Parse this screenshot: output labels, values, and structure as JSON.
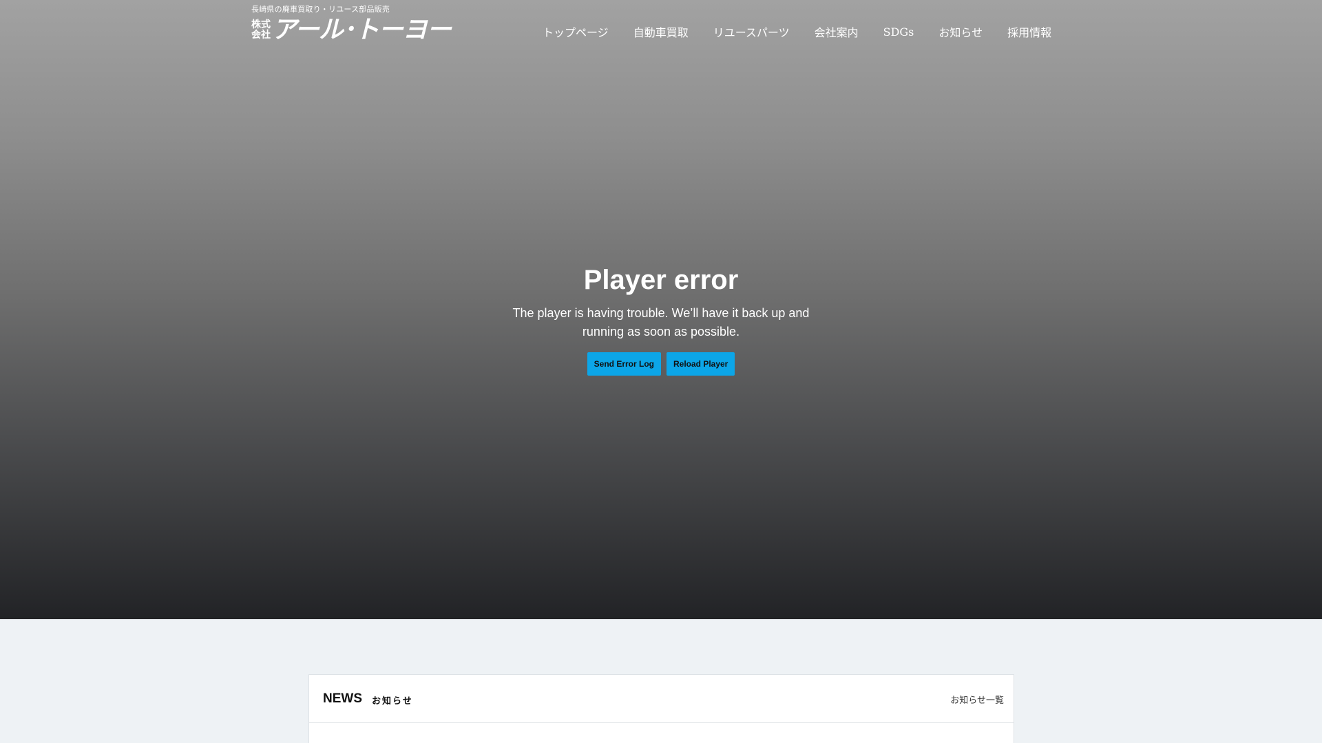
{
  "header": {
    "tagline": "長崎県の廃車買取り・リユース部品販売",
    "logo_corp_line1": "株式",
    "logo_corp_line2": "会社",
    "logo_name": "アール･トーヨー"
  },
  "nav": {
    "items": [
      {
        "label": "トップページ"
      },
      {
        "label": "自動車買取"
      },
      {
        "label": "リユースパーツ"
      },
      {
        "label": "会社案内"
      },
      {
        "label": "SDGs"
      },
      {
        "label": "お知らせ"
      },
      {
        "label": "採用情報"
      }
    ]
  },
  "player_error": {
    "title": "Player error",
    "message": "The player is having trouble. We’ll have it back up and running as soon as possible.",
    "send_log_label": "Send Error Log",
    "reload_label": "Reload Player"
  },
  "news": {
    "title": "NEWS",
    "subtitle": "お知らせ",
    "all_link": "お知らせ一覧"
  },
  "colors": {
    "button_bg": "#0ca6e8",
    "page_bg": "#eef2f5",
    "hero_top": "#a2a2a2",
    "hero_bottom": "#222326"
  }
}
